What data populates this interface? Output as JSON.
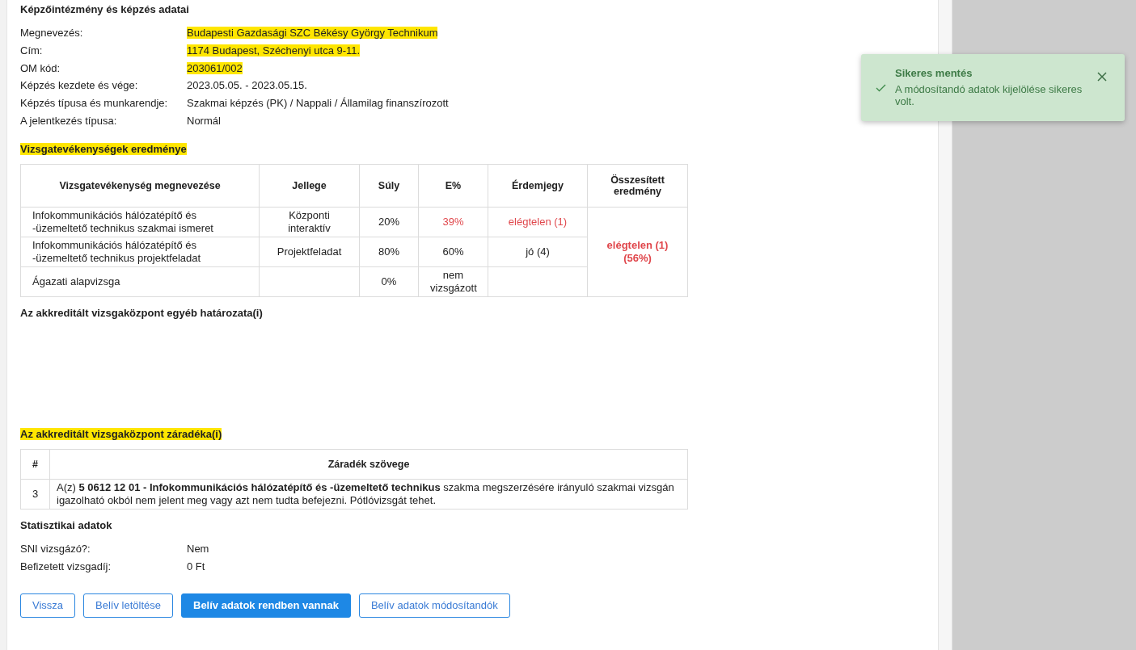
{
  "institution": {
    "title": "Képzőintézmény és képzés adatai",
    "highlighted": false,
    "fields": [
      {
        "label": "Megnevezés:",
        "value": "Budapesti Gazdasági SZC Békésy György Technikum",
        "highlighted": true
      },
      {
        "label": "Cím:",
        "value": "1174 Budapest, Széchenyi utca 9-11.",
        "highlighted": true
      },
      {
        "label": "OM kód:",
        "value": "203061/002",
        "highlighted": true
      },
      {
        "label": "Képzés kezdete és vége:",
        "value": "2023.05.05. - 2023.05.15.",
        "highlighted": false
      },
      {
        "label": "Képzés típusa és munkarendje:",
        "value": "Szakmai képzés (PK) / Nappali / Államilag finanszírozott",
        "highlighted": false
      },
      {
        "label": "A jelentkezés típusa:",
        "value": "Normál",
        "highlighted": false
      }
    ]
  },
  "results": {
    "title": "Vizsgatevékenységek eredménye",
    "highlighted": true,
    "columns": [
      "Vizsgatevékenység megnevezése",
      "Jellege",
      "Súly",
      "E%",
      "Érdemjegy",
      "Összesített eredmény"
    ],
    "rows": [
      {
        "name": "Infokommunikációs hálózatépítő és -üzemeltető technikus szakmai ismeret",
        "type": "Központi interaktív",
        "weight": "20%",
        "percent": "39%",
        "grade": "elégtelen (1)",
        "failed": true
      },
      {
        "name": "Infokommunikációs hálózatépítő és -üzemeltető technikus projektfeladat",
        "type": "Projektfeladat",
        "weight": "80%",
        "percent": "60%",
        "grade": "jó (4)",
        "failed": false
      },
      {
        "name": "Ágazati alapvizsga",
        "weight": "0%",
        "percent": "nem vizsgázott",
        "failed": false
      }
    ],
    "summary": {
      "grade": "elégtelen (1)",
      "percent": "(56%)",
      "failed": true
    }
  },
  "decisions": {
    "title": "Az akkreditált vizsgaközpont egyéb határozata(i)",
    "highlighted": false
  },
  "clauses": {
    "title": "Az akkreditált vizsgaközpont záradéka(i)",
    "highlighted": true,
    "columns": [
      "#",
      "Záradék szövege"
    ],
    "rows": [
      {
        "number": "3",
        "text": "A(z) **5 0612 12 01 - Infokommunikációs hálózatépítő és -üzemeltető technikus** szakma megszerzésére irányuló szakmai vizsgán igazolható okból nem jelent meg vagy azt nem tudta befejezni. Pótlóvizsgát tehet."
      }
    ]
  },
  "statistics": {
    "title": "Statisztikai adatok",
    "highlighted": false,
    "fields": [
      {
        "label": "SNI vizsgázó?:",
        "value": "Nem",
        "highlighted": false
      },
      {
        "label": "Befizetett vizsgadíj:",
        "value": "0 Ft",
        "highlighted": false
      }
    ]
  },
  "buttons": [
    {
      "label": "Vissza",
      "kind": "outline"
    },
    {
      "label": "Belív letöltése",
      "kind": "outline"
    },
    {
      "label": "Belív adatok rendben vannak",
      "kind": "primary"
    },
    {
      "label": "Belív adatok módosítandók",
      "kind": "outline"
    }
  ],
  "toast": {
    "title": "Sikeres mentés",
    "message": "A módosítandó adatok kijelölése sikeres volt."
  }
}
